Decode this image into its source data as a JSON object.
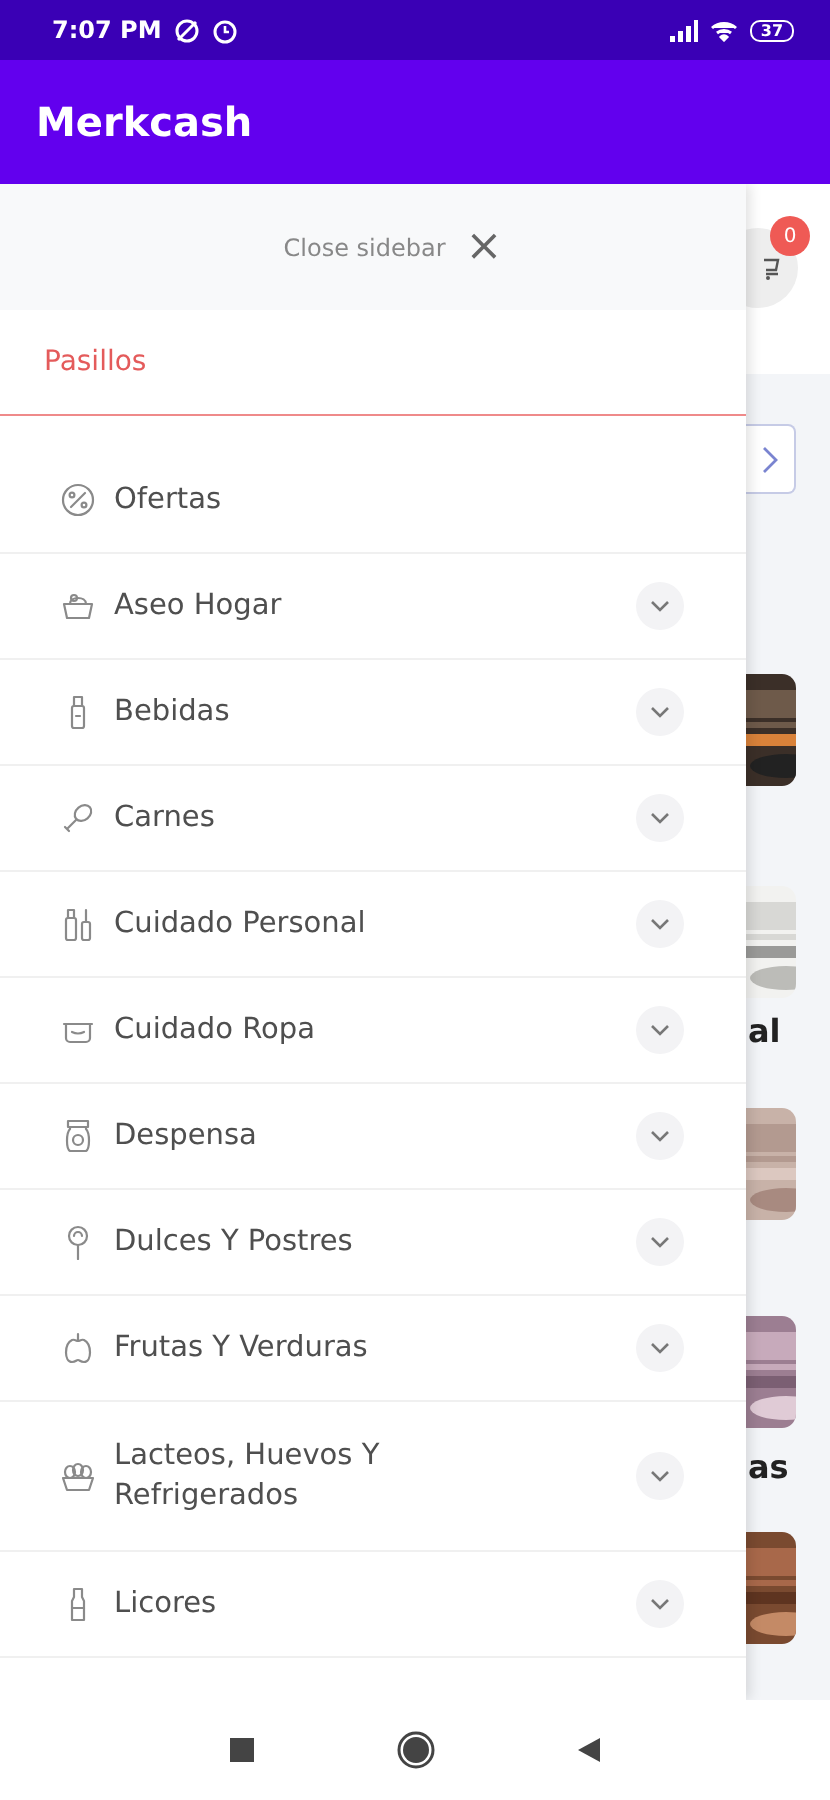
{
  "status_bar": {
    "time": "7:07 PM",
    "battery": "37"
  },
  "app_bar": {
    "title": "Merkcash"
  },
  "sidebar": {
    "close_label": "Close sidebar",
    "close_icon": "×",
    "section_title": "Pasillos",
    "items": [
      {
        "label": "Ofertas",
        "kind": "link"
      },
      {
        "label": "Aseo Hogar",
        "kind": "group"
      },
      {
        "label": "Bebidas",
        "kind": "group"
      },
      {
        "label": "Carnes",
        "kind": "group"
      },
      {
        "label": "Cuidado Personal",
        "kind": "group"
      },
      {
        "label": "Cuidado Ropa",
        "kind": "group"
      },
      {
        "label": "Despensa",
        "kind": "group"
      },
      {
        "label": "Dulces Y Postres",
        "kind": "group"
      },
      {
        "label": "Frutas Y Verduras",
        "kind": "group"
      },
      {
        "label": "Lacteos, Huevos Y Refrigerados",
        "kind": "group"
      },
      {
        "label": "Licores",
        "kind": "group"
      }
    ]
  },
  "background_page": {
    "cart_count": "0",
    "captions": [
      "al",
      "as"
    ]
  }
}
